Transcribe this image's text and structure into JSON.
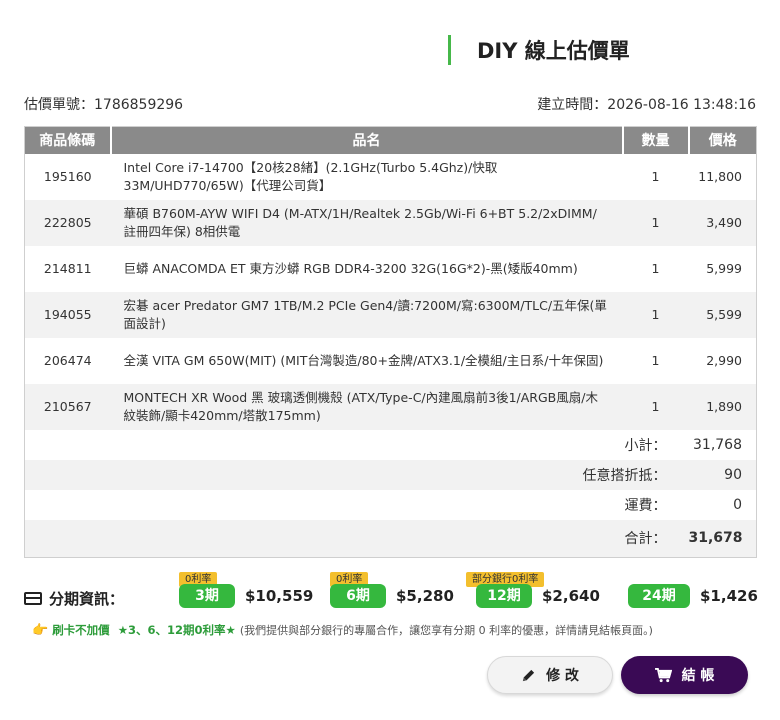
{
  "header": {
    "title": "DIY 線上估價單"
  },
  "meta": {
    "quote_no": "估價單號：1786859296",
    "created": "建立時間：2026-08-16 13:48:16"
  },
  "table": {
    "headers": {
      "code": "商品條碼",
      "name": "品名",
      "qty": "數量",
      "price": "價格"
    },
    "rows": [
      {
        "code": "195160",
        "name": "Intel Core i7-14700【20核28緒】(2.1GHz(Turbo 5.4Ghz)/快取33M/UHD770/65W)【代理公司貨】",
        "qty": "1",
        "price": "11,800"
      },
      {
        "code": "222805",
        "name": "華碩 B760M-AYW WIFI D4 (M-ATX/1H/Realtek 2.5Gb/Wi-Fi 6+BT 5.2/2xDIMM/註冊四年保) 8相供電",
        "qty": "1",
        "price": "3,490"
      },
      {
        "code": "214811",
        "name": "巨蟒 ANACOMDA ET 東方沙蟒 RGB DDR4-3200 32G(16G*2)-黑(矮版40mm)",
        "qty": "1",
        "price": "5,999"
      },
      {
        "code": "194055",
        "name": "宏碁 acer Predator GM7 1TB/M.2 PCIe Gen4/讀:7200M/寫:6300M/TLC/五年保(單面設計)",
        "qty": "1",
        "price": "5,599"
      },
      {
        "code": "206474",
        "name": "全漢 VITA GM 650W(MIT) (MIT台灣製造/80+金牌/ATX3.1/全模組/主日系/十年保固)",
        "qty": "1",
        "price": "2,990"
      },
      {
        "code": "210567",
        "name": "MONTECH XR Wood 黑 玻璃透側機殼 (ATX/Type-C/內建風扇前3後1/ARGB風扇/木紋裝飾/顯卡420mm/塔散175mm)",
        "qty": "1",
        "price": "1,890"
      }
    ],
    "subtotal": {
      "label": "小計：",
      "value": "31,768"
    },
    "discount": {
      "label": "任意搭折抵：",
      "value": "90"
    },
    "shipping": {
      "label": "運費：",
      "value": "0"
    },
    "total": {
      "label": "合計：",
      "value": "31,678"
    }
  },
  "installment": {
    "label": "分期資訊：",
    "plans": [
      {
        "tag": "0利率",
        "period": "3期",
        "amount": "$10,559"
      },
      {
        "tag": "0利率",
        "period": "6期",
        "amount": "$5,280"
      },
      {
        "tag": "部分銀行0利率",
        "period": "12期",
        "amount": "$2,640"
      },
      {
        "tag": "",
        "period": "24期",
        "amount": "$1,426"
      }
    ]
  },
  "promo": {
    "icon": "👉",
    "part1": "刷卡不加價",
    "part2": "★3、6、12期0利率★",
    "part3": "(我們提供與部分銀行的專屬合作，讓您享有分期 0 利率的優惠，詳情請見結帳頁面。)"
  },
  "actions": {
    "edit": "修 改",
    "checkout": "結 帳"
  },
  "colors": {
    "accent_green": "#35b83e",
    "checkout_purple": "#3a0a55",
    "total_red": "#ff1f1f",
    "tag_yellow": "#f3bf2d"
  }
}
